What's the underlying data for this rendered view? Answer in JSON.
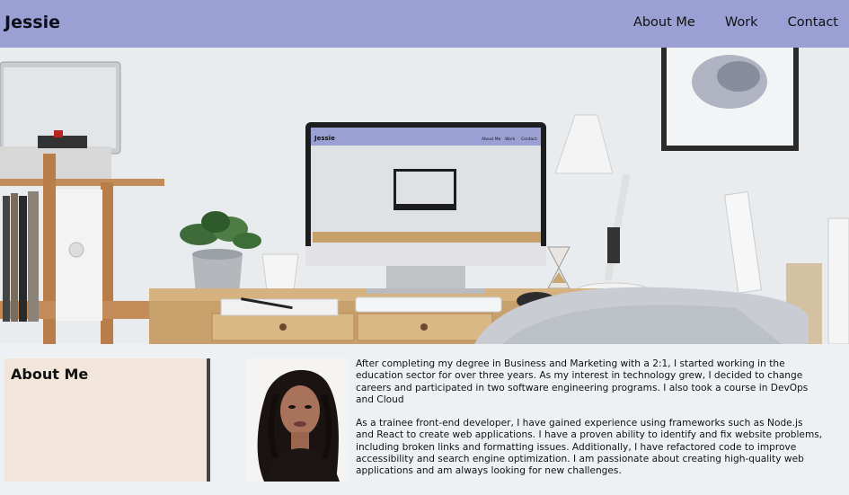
{
  "header": {
    "brand": "Jessie",
    "nav": [
      {
        "label": "About Me"
      },
      {
        "label": "Work"
      },
      {
        "label": "Contact"
      }
    ]
  },
  "hero": {
    "screen": {
      "brand": "Jessie",
      "nav": [
        "About Me",
        "Work",
        "Contact"
      ]
    }
  },
  "about": {
    "title": "About Me",
    "paragraphs": [
      "After completing my degree in Business and Marketing with a 2:1, I started working in the education sector for over three years. As my interest in technology grew, I decided to change careers and participated in two software engineering programs. I also took a course in DevOps and Cloud",
      "As a trainee front-end developer, I have gained experience using frameworks such as Node.js and React to create web applications. I have a proven ability to identify and fix website problems, including broken links and formatting issues. Additionally, I have refactored code to improve accessibility and search engine optimization. I am passionate about creating high-quality web applications and am always looking for new challenges."
    ]
  },
  "colors": {
    "header_bg": "#9aa0d4",
    "card_bg": "#f1e6d9",
    "page_bg": "#eef1f4"
  }
}
